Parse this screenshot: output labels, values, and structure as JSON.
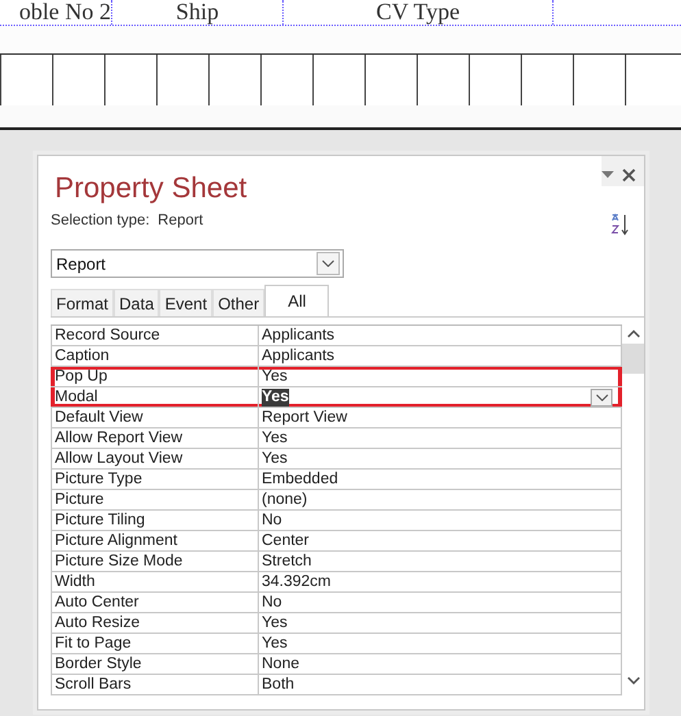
{
  "report_header": {
    "labels": [
      "oble No 2",
      "Ship",
      "CV Type"
    ]
  },
  "property_sheet": {
    "title": "Property Sheet",
    "selection_type_label": "Selection type:",
    "selection_type": "Report",
    "object_select": {
      "value": "Report"
    },
    "tabs": [
      {
        "label": "Format",
        "selected": false
      },
      {
        "label": "Data",
        "selected": false
      },
      {
        "label": "Event",
        "selected": false
      },
      {
        "label": "Other",
        "selected": false
      },
      {
        "label": "All",
        "selected": true
      }
    ],
    "rows": [
      {
        "name": "Record Source",
        "value": "Applicants",
        "selected": false,
        "marked": false
      },
      {
        "name": "Caption",
        "value": "Applicants",
        "selected": false,
        "marked": false
      },
      {
        "name": "Pop Up",
        "value": "Yes",
        "selected": false,
        "marked": true
      },
      {
        "name": "Modal",
        "value": "Yes",
        "selected": true,
        "marked": true
      },
      {
        "name": "Default View",
        "value": "Report View",
        "selected": false,
        "marked": false
      },
      {
        "name": "Allow Report View",
        "value": "Yes",
        "selected": false,
        "marked": false
      },
      {
        "name": "Allow Layout View",
        "value": "Yes",
        "selected": false,
        "marked": false
      },
      {
        "name": "Picture Type",
        "value": "Embedded",
        "selected": false,
        "marked": false
      },
      {
        "name": "Picture",
        "value": "(none)",
        "selected": false,
        "marked": false
      },
      {
        "name": "Picture Tiling",
        "value": "No",
        "selected": false,
        "marked": false
      },
      {
        "name": "Picture Alignment",
        "value": "Center",
        "selected": false,
        "marked": false
      },
      {
        "name": "Picture Size Mode",
        "value": "Stretch",
        "selected": false,
        "marked": false
      },
      {
        "name": "Width",
        "value": "34.392cm",
        "selected": false,
        "marked": false
      },
      {
        "name": "Auto Center",
        "value": "No",
        "selected": false,
        "marked": false
      },
      {
        "name": "Auto Resize",
        "value": "Yes",
        "selected": false,
        "marked": false
      },
      {
        "name": "Fit to Page",
        "value": "Yes",
        "selected": false,
        "marked": false
      },
      {
        "name": "Border Style",
        "value": "None",
        "selected": false,
        "marked": false
      },
      {
        "name": "Scroll Bars",
        "value": "Both",
        "selected": false,
        "marked": false
      }
    ]
  }
}
